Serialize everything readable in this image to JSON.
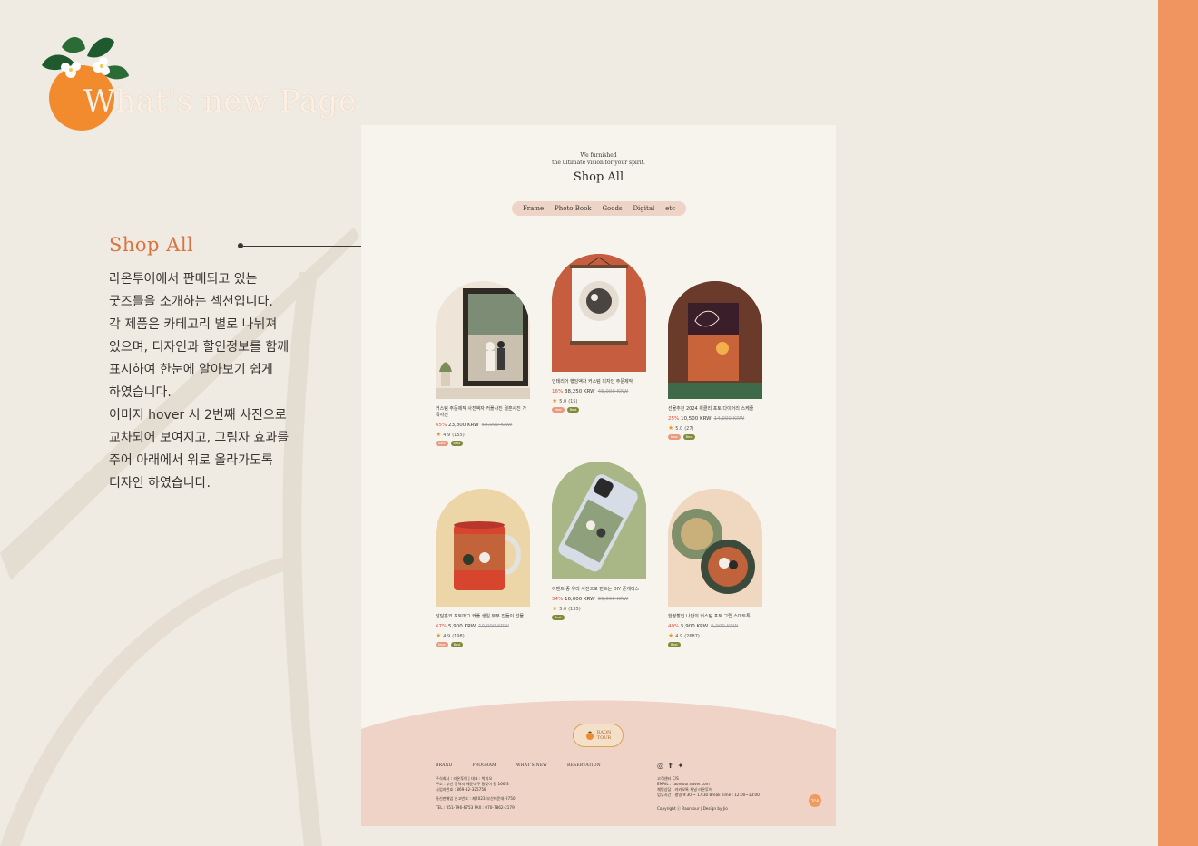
{
  "page": {
    "title": "What's new Page",
    "accent_color": "#f0955f",
    "heading_color": "#d9743f"
  },
  "description": {
    "heading": "Shop All",
    "lines": [
      "라온투어에서 판매되고 있는",
      "굿즈들을 소개하는 섹션입니다.",
      "각 제품은 카테고리 별로 나눠져",
      "있으며, 디자인과 할인정보를 함께",
      "표시하여 한눈에 알아보기 쉽게",
      "하였습니다.",
      "이미지 hover 시 2번째 사진으로",
      "교차되어 보여지고, 그림자 효과를",
      "주어 아래에서 위로 올라가도록",
      "디자인 하였습니다."
    ]
  },
  "mockup": {
    "tagline_1": "We furnished",
    "tagline_2": "the ultimate vision for your spirit.",
    "title": "Shop All",
    "tabs": [
      "Frame",
      "Photo Book",
      "Goods",
      "Digital",
      "etc"
    ],
    "products": [
      {
        "name": "커스텀 주문제작 사진액자 커플사진 결혼사진 가족사진",
        "discount": "65%",
        "price": "23,800 KRW",
        "original": "68,000 KRW",
        "rating": "4.9",
        "reviews": "(155)",
        "badges": [
          "Sale",
          "Best"
        ]
      },
      {
        "name": "인테리어 행잉액자 커스텀 디자인 주문제작",
        "discount": "16%",
        "price": "38,250 KRW",
        "original": "45,000 KRW",
        "rating": "5.0",
        "reviews": "(15)",
        "badges": [
          "New",
          "Best"
        ]
      },
      {
        "name": "선물추천 2024 위클리 포토 다이어리 스케줄",
        "discount": "25%",
        "price": "10,500 KRW",
        "original": "14,000 KRW",
        "rating": "5.0",
        "reviews": "(27)",
        "badges": [
          "New",
          "Best"
        ]
      },
      {
        "name": "달달홈코 포토머그 커플 생일 부부 집들이 선물",
        "discount": "67%",
        "price": "5,900 KRW",
        "original": "10,000 KRW",
        "rating": "4.9",
        "reviews": "(198)",
        "badges": [
          "New",
          "Best"
        ]
      },
      {
        "name": "이벤트 중 우리 사진으로 만드는 DIY 폰케이스",
        "discount": "54%",
        "price": "16,000 KRW",
        "original": "35,000 KRW",
        "rating": "5.0",
        "reviews": "(135)",
        "badges": [
          "Best"
        ]
      },
      {
        "name": "한정할인 나만의 커스텀 포토 그립 스마트톡",
        "discount": "40%",
        "price": "5,900 KRW",
        "original": "9,900 KRW",
        "rating": "4.9",
        "reviews": "(2687)",
        "badges": [
          "Best"
        ]
      }
    ],
    "footer": {
      "logo_line1": "RAON",
      "logo_line2": "TOUR",
      "nav": [
        "BRAND",
        "PROGRAM",
        "WHAT'S NEW",
        "RESERVATION"
      ],
      "company": [
        "주식회사 : 라온투어 | 대표 : 박지오",
        "주소 : 부산 광역시 해운대구 달맞이 길 166-3",
        "사업자번호 : 869-12-325758"
      ],
      "company2": [
        "통신판매업 신고번호 : 제2023-부산해운대-2750",
        "TEL : 051-796-6753  FAX : 070-7862-2179"
      ],
      "cs": [
        "고객센터 C/S",
        "EMAIL : raontour.naver.com",
        "채팅상담 : 카카오톡 채널 라온투어",
        "업무시간 : 평일 9:30 ~ 17:30 Break Time : 12:00~13:00"
      ],
      "copyright": "Copyright ⓒ Raontour  |  Design by Jio",
      "top_label": "TOP",
      "social_icons": [
        "instagram-icon",
        "facebook-icon",
        "twitter-icon"
      ]
    }
  }
}
